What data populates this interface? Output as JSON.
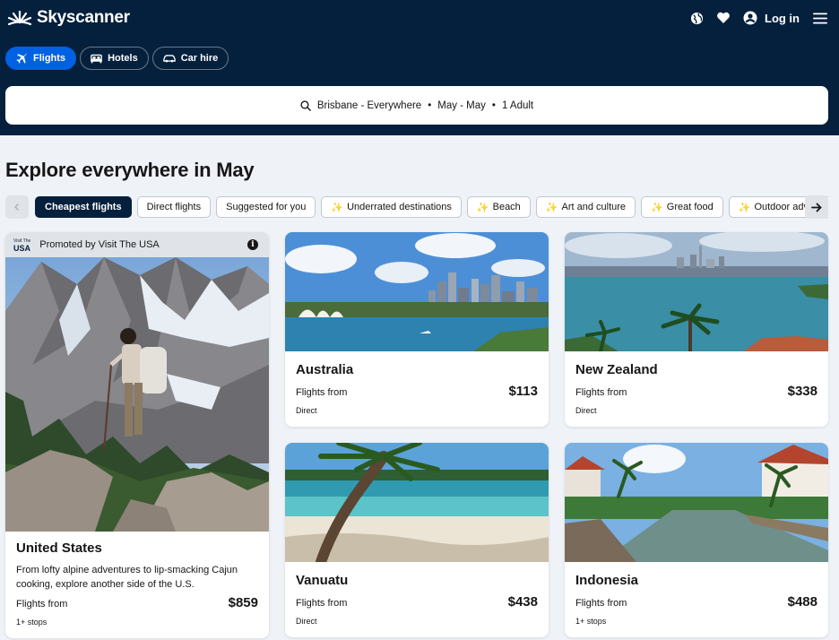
{
  "brand": {
    "name": "Skyscanner"
  },
  "header": {
    "login_label": "Log in"
  },
  "tabs": [
    {
      "label": "Flights",
      "icon": "plane-icon",
      "active": true
    },
    {
      "label": "Hotels",
      "icon": "bed-icon",
      "active": false
    },
    {
      "label": "Car hire",
      "icon": "car-icon",
      "active": false
    }
  ],
  "search": {
    "origin_dest": "Brisbane - Everywhere",
    "dates": "May - May",
    "travellers": "1 Adult",
    "separator": "•"
  },
  "explore": {
    "title": "Explore everywhere in May"
  },
  "chips": [
    {
      "label": "Cheapest flights",
      "active": true,
      "spark": false
    },
    {
      "label": "Direct flights",
      "active": false,
      "spark": false
    },
    {
      "label": "Suggested for you",
      "active": false,
      "spark": false
    },
    {
      "label": "Underrated destinations",
      "active": false,
      "spark": true
    },
    {
      "label": "Beach",
      "active": false,
      "spark": true
    },
    {
      "label": "Art and culture",
      "active": false,
      "spark": true
    },
    {
      "label": "Great food",
      "active": false,
      "spark": true
    },
    {
      "label": "Outdoor adventures",
      "active": false,
      "spark": true
    }
  ],
  "promo": {
    "usa_logo_small": "Visit The",
    "usa_logo": "USA",
    "promoted_label": "Promoted by Visit The USA",
    "info_label": "i",
    "destination": "United States",
    "description": "From lofty alpine adventures to lip-smacking Cajun cooking, explore another side of the U.S.",
    "flights_from": "Flights from",
    "price": "$859",
    "stops": "1+ stops"
  },
  "destinations": [
    {
      "name": "Australia",
      "flights_from": "Flights from",
      "price": "$113",
      "stops": "Direct"
    },
    {
      "name": "New Zealand",
      "flights_from": "Flights from",
      "price": "$338",
      "stops": "Direct"
    },
    {
      "name": "Vanuatu",
      "flights_from": "Flights from",
      "price": "$438",
      "stops": "Direct"
    },
    {
      "name": "Indonesia",
      "flights_from": "Flights from",
      "price": "$488",
      "stops": "1+ stops"
    }
  ],
  "colors": {
    "header_bg": "#05203c",
    "accent": "#0062e3",
    "page_bg": "#eff3f8",
    "spark": "#f5a623"
  }
}
